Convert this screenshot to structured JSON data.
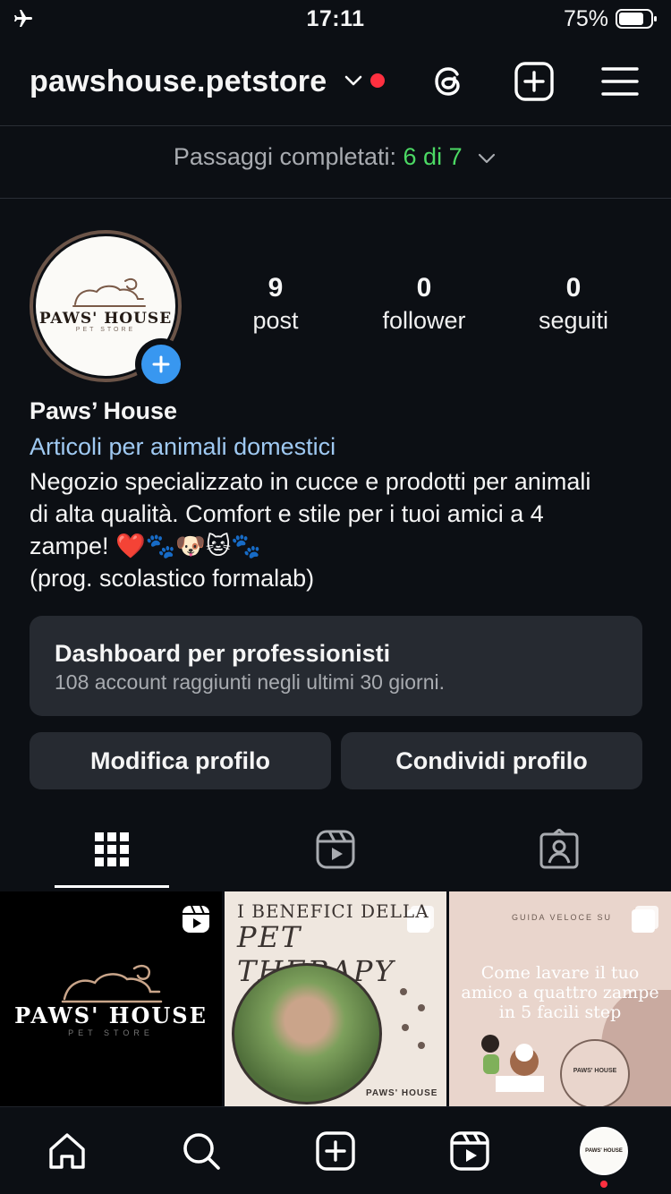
{
  "status_bar": {
    "time": "17:11",
    "battery_percent": "75%",
    "icons": [
      "airplane-mode-icon",
      "battery-icon"
    ]
  },
  "header": {
    "username": "pawshouse.petstore",
    "icons": [
      "chevron-down-icon",
      "notification-dot",
      "threads-icon",
      "create-post-icon",
      "menu-icon"
    ]
  },
  "setup": {
    "label": "Passaggi completati:",
    "count": "6 di 7"
  },
  "profile": {
    "avatar_logo": "PAWS' HOUSE",
    "avatar_logo_sub": "PET STORE",
    "stats": [
      {
        "value": "9",
        "label": "post"
      },
      {
        "value": "0",
        "label": "follower"
      },
      {
        "value": "0",
        "label": "seguiti"
      }
    ],
    "name": "Paws’ House",
    "category": "Articoli per animali domestici",
    "bio_line1": "Negozio specializzato in cucce e prodotti per animali",
    "bio_line2": "di alta qualità. Comfort e stile per i tuoi amici a 4",
    "bio_line3": "zampe! ❤️🐾🐶🐱🐾",
    "bio_line4": "(prog. scolastico formalab)"
  },
  "dashboard": {
    "title": "Dashboard per professionisti",
    "subtitle": "108 account raggiunti negli ultimi 30 giorni."
  },
  "actions": {
    "edit_profile": "Modifica profilo",
    "share_profile": "Condividi profilo"
  },
  "tabs": [
    "grid-icon",
    "reels-icon",
    "tagged-icon"
  ],
  "posts": [
    {
      "type": "reel",
      "title": "PAWS' HOUSE",
      "subtitle": "PET STORE"
    },
    {
      "type": "carousel",
      "title_line1": "I BENEFICI DELLA",
      "title_line2": "PET THERAPY",
      "brand": "PAWS' HOUSE"
    },
    {
      "type": "carousel",
      "kicker": "GUIDA VELOCE SU",
      "title": "Come lavare il tuo amico a quattro zampe in 5 facili step",
      "brand": "PAWS' HOUSE"
    }
  ],
  "bottom_nav": {
    "avatar_label": "PAWS' HOUSE",
    "icons": [
      "home-icon",
      "search-icon",
      "create-icon",
      "reels-icon",
      "profile-avatar"
    ]
  }
}
